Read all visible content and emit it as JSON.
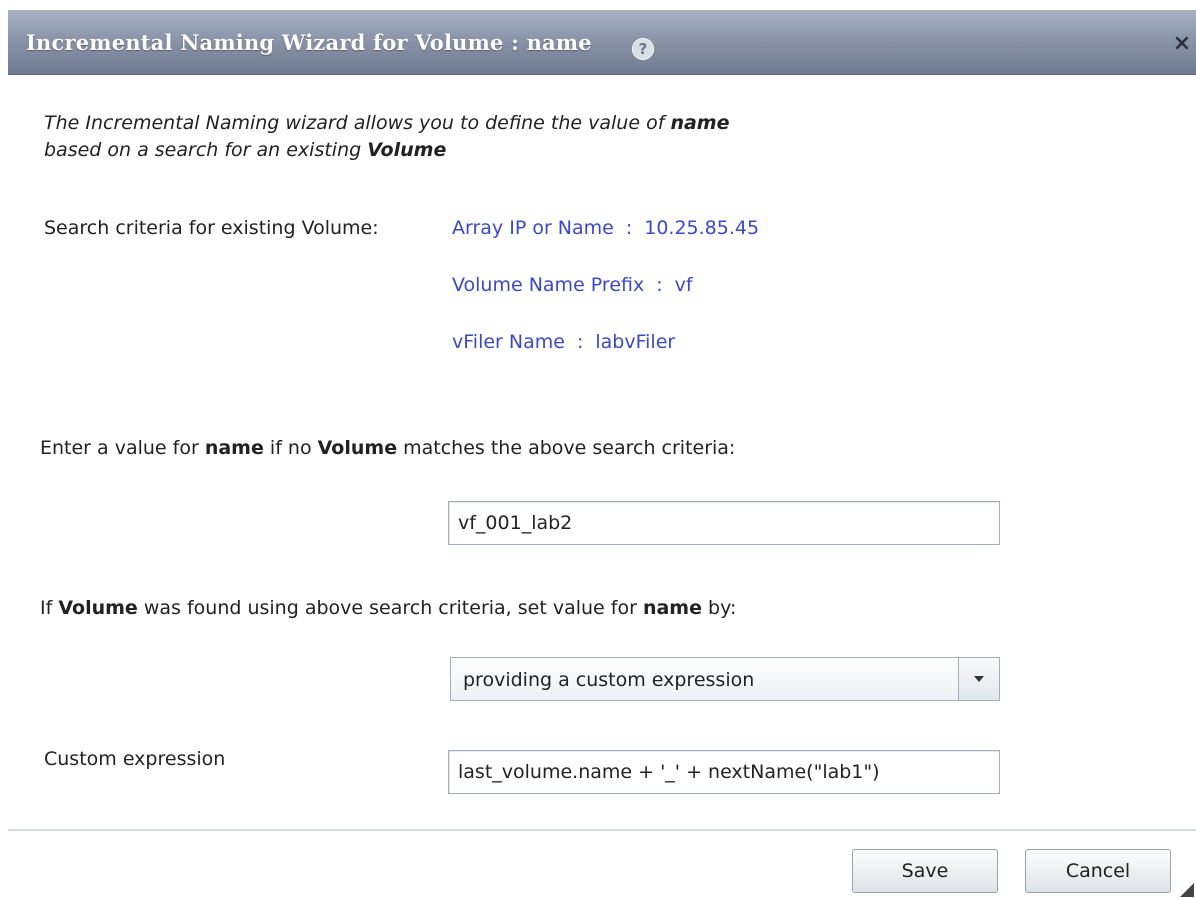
{
  "window": {
    "title": "Incremental Naming Wizard for Volume : name",
    "help_icon": "help-icon",
    "close_glyph": "×"
  },
  "intro": {
    "line1_prefix": "The Incremental Naming wizard allows you to define the value of ",
    "line1_bold": "name",
    "line2_prefix": "based on a search for an existing ",
    "line2_bold": "Volume"
  },
  "criteria": {
    "label": "Search criteria for existing Volume:",
    "items": [
      {
        "key": "Array IP or Name",
        "sep": ":",
        "value": "10.25.85.45"
      },
      {
        "key": "Volume Name Prefix",
        "sep": ":",
        "value": "vf"
      },
      {
        "key": "vFiler Name",
        "sep": ":",
        "value": "labvFiler"
      }
    ]
  },
  "default_value": {
    "label_p1": "Enter a value for ",
    "label_b1": "name",
    "label_p2": " if no ",
    "label_b2": "Volume",
    "label_p3": " matches the above search criteria:",
    "input_value": "vf_001_lab2"
  },
  "found_rule": {
    "label_p1": "If ",
    "label_b1": "Volume",
    "label_p2": " was found using above search criteria, set value for ",
    "label_b2": "name",
    "label_p3": " by:",
    "selected_option": "providing a custom expression"
  },
  "custom_expression": {
    "label": "Custom expression",
    "value": "last_volume.name + '_' + nextName(\"lab1\")"
  },
  "buttons": {
    "save": "Save",
    "cancel": "Cancel"
  },
  "colors": {
    "title_bar": "#8a95a9",
    "criteria_text": "#3b49c8"
  }
}
